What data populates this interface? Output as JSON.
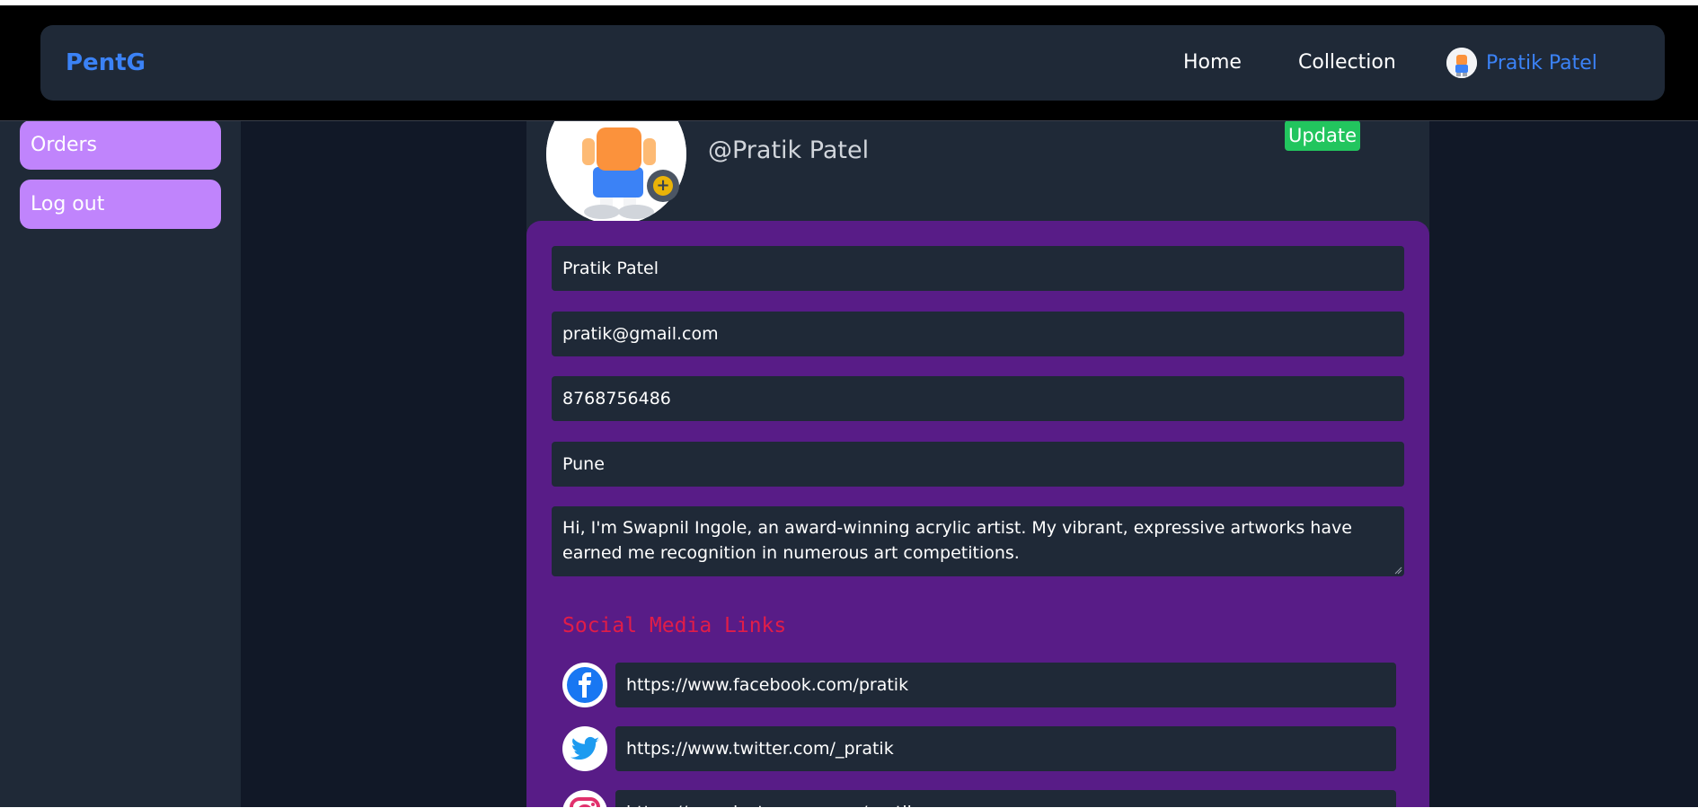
{
  "navbar": {
    "brand": "PentG",
    "links": [
      {
        "label": "Home"
      },
      {
        "label": "Collection"
      }
    ],
    "user_name": "Pratik Patel"
  },
  "sidebar": {
    "items": [
      {
        "label": "Orders"
      },
      {
        "label": "Log out"
      }
    ]
  },
  "profile": {
    "name": "Pratik Patel",
    "handle": "@Pratik Patel",
    "update_label": "Update"
  },
  "form": {
    "full_name": "Pratik Patel",
    "email": "pratik@gmail.com",
    "phone": "8768756486",
    "city": "Pune",
    "bio": "Hi, I'm Swapnil Ingole, an award-winning acrylic artist. My vibrant, expressive artworks have earned me recognition in numerous art competitions."
  },
  "social": {
    "title": "Social Media Links",
    "links": [
      {
        "icon": "facebook-icon",
        "url": "https://www.facebook.com/pratik"
      },
      {
        "icon": "twitter-icon",
        "url": "https://www.twitter.com/_pratik"
      },
      {
        "icon": "instagram-icon",
        "url": "https://www.instagram.com/pratik"
      }
    ]
  },
  "colors": {
    "brand": "#3b82f6",
    "sidebar_button": "#c084fc",
    "form_card": "#581c87",
    "update_button": "#22c55e",
    "social_title": "#e11d48"
  }
}
